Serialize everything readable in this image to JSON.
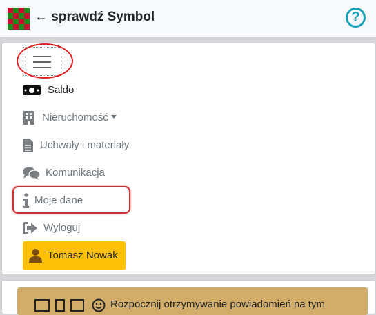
{
  "header": {
    "title": "← sprawdź Symbol",
    "logo_icon": "checkered-logo",
    "help_label": "?",
    "accent": "#17a2b8"
  },
  "menu": {
    "toggler_icon": "hamburger-icon",
    "items": [
      {
        "label": "Saldo",
        "icon": "money-icon"
      },
      {
        "label": "Nieruchomość",
        "icon": "building-icon",
        "dropdown": true
      },
      {
        "label": "Uchwały i materiały",
        "icon": "document-icon"
      },
      {
        "label": "Komunikacja",
        "icon": "comments-icon"
      },
      {
        "label": "Moje dane",
        "icon": "info-icon"
      },
      {
        "label": "Wyloguj",
        "icon": "sign-out-icon"
      }
    ],
    "user": {
      "label": "Tomasz Nowak",
      "icon": "user-icon",
      "color": "#ffc107"
    }
  },
  "notification": {
    "text": "Rozpocznij otrzymywanie powiadomień na tym",
    "icon": "smile-icon",
    "color": "#d2ad6a"
  }
}
